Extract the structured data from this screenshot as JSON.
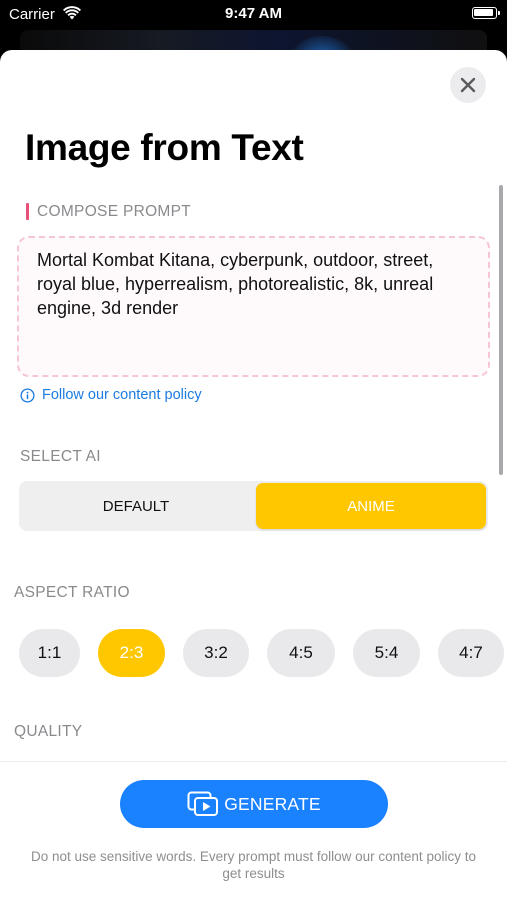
{
  "status_bar": {
    "carrier": "Carrier",
    "time": "9:47 AM"
  },
  "header": {
    "title": "Image from Text"
  },
  "prompt": {
    "section_label": "COMPOSE PROMPT",
    "text": "Mortal Kombat Kitana, cyberpunk, outdoor, street, royal blue, hyperrealism, photorealistic, 8k, unreal engine, 3d render",
    "policy_link": "Follow our content policy"
  },
  "select_ai": {
    "section_label": "SELECT AI",
    "options": [
      "DEFAULT",
      "ANIME"
    ],
    "selected": "ANIME"
  },
  "aspect_ratio": {
    "section_label": "ASPECT RATIO",
    "options": [
      "1:1",
      "2:3",
      "3:2",
      "4:5",
      "5:4",
      "4:7"
    ],
    "selected": "2:3"
  },
  "quality": {
    "section_label": "QUALITY"
  },
  "footer": {
    "generate_label": "GENERATE",
    "disclaimer": "Do not use sensitive words. Every prompt must follow our content policy to get results"
  },
  "colors": {
    "accent": "#ffc700",
    "primary": "#1a82ff",
    "compose_marker": "#e8507a",
    "link": "#1c7be0"
  },
  "icons": [
    "wifi-icon",
    "battery-icon",
    "close-icon",
    "info-icon",
    "generate-image-icon"
  ]
}
